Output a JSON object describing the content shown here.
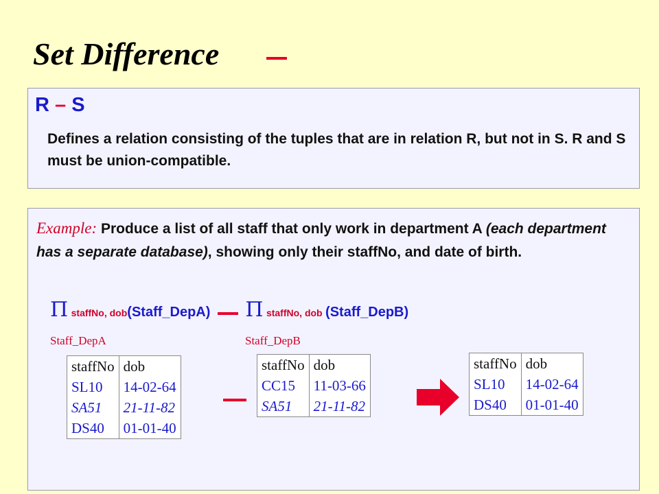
{
  "title": "Set Difference",
  "definition": {
    "heading_r": "R",
    "heading_minus": "–",
    "heading_s": "S",
    "text": "Defines a relation consisting of the tuples that are in relation R, but not in S.  R and S must be union-compatible."
  },
  "example": {
    "label": "Example:",
    "part1": "Produce a list of all staff that only work in department A ",
    "part2_italic": "(each department has a separate database)",
    "part3": ", showing only their staffNo, and date of birth."
  },
  "expression": {
    "pi": "Π",
    "sub1": "staffNo, dob",
    "rel1": "(Staff_DepA)",
    "sub2": "staffNo, dob",
    "rel2": "(Staff_DepB)"
  },
  "tables": {
    "a": {
      "label": "Staff_DepA",
      "headers": [
        "staffNo",
        "dob"
      ],
      "rows": [
        [
          "SL10",
          "14-02-64"
        ],
        [
          "SA51",
          "21-11-82"
        ],
        [
          "DS40",
          "01-01-40"
        ]
      ]
    },
    "b": {
      "label": "Staff_DepB",
      "headers": [
        "staffNo",
        "dob"
      ],
      "rows": [
        [
          "CC15",
          "11-03-66"
        ],
        [
          "SA51",
          "21-11-82"
        ]
      ]
    },
    "result": {
      "headers": [
        "staffNo",
        "dob"
      ],
      "rows": [
        [
          "SL10",
          "14-02-64"
        ],
        [
          "DS40",
          "01-01-40"
        ]
      ]
    }
  },
  "colors": {
    "background": "#ffffcc",
    "accent_red": "#e8002a",
    "accent_blue": "#1a1acc",
    "panel": "#f3f3ff"
  }
}
